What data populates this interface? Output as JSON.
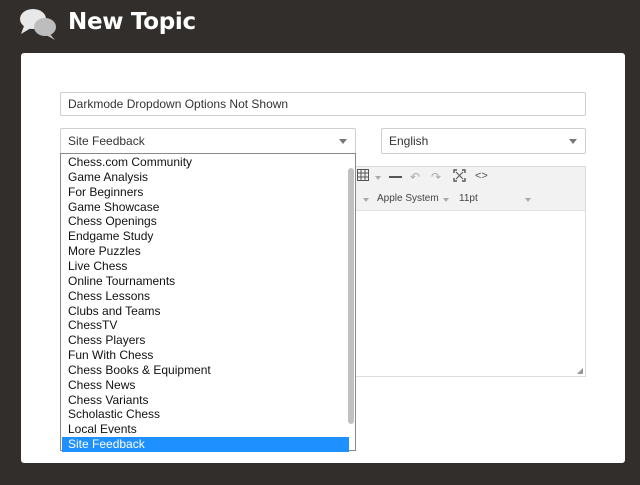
{
  "header": {
    "title": "New Topic",
    "logo_icon": "chat-bubbles-icon"
  },
  "form": {
    "topic_title_value": "Darkmode Dropdown Options Not Shown",
    "category_selected": "Site Feedback",
    "language_selected": "English"
  },
  "editor": {
    "font_family": "Apple System",
    "font_size": "11pt",
    "toolbar_icons": [
      "table-icon",
      "horizontal-line-icon",
      "undo-icon",
      "redo-icon",
      "fullscreen-icon",
      "source-code-icon"
    ]
  },
  "category_dropdown": {
    "options": [
      "Chess.com Community",
      "Game Analysis",
      "For Beginners",
      "Game Showcase",
      "Chess Openings",
      "Endgame Study",
      "More Puzzles",
      "Live Chess",
      "Online Tournaments",
      "Chess Lessons",
      "Clubs and Teams",
      "ChessTV",
      "Chess Players",
      "Fun With Chess",
      "Chess Books & Equipment",
      "Chess News",
      "Chess Variants",
      "Scholastic Chess",
      "Local Events",
      "Site Feedback"
    ],
    "selected": "Site Feedback"
  },
  "colors": {
    "background": "#312e2b",
    "card": "#ffffff",
    "selection": "#1e90ff"
  }
}
